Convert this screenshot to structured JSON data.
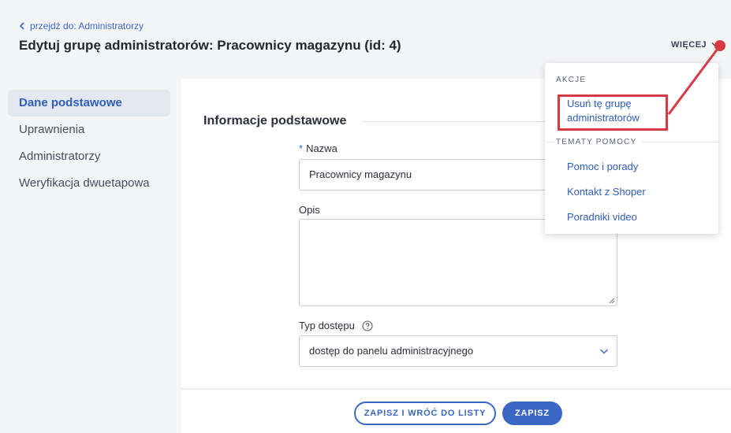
{
  "header": {
    "breadcrumb": "przejdź do: Administratorzy",
    "title": "Edytuj grupę administratorów: Pracownicy magazynu (id: 4)",
    "more_label": "WIĘCEJ"
  },
  "sidebar": {
    "items": [
      {
        "label": "Dane podstawowe",
        "active": true
      },
      {
        "label": "Uprawnienia"
      },
      {
        "label": "Administratorzy"
      },
      {
        "label": "Weryfikacja dwuetapowa"
      }
    ]
  },
  "main": {
    "section_title": "Informacje podstawowe",
    "name": {
      "required_mark": "*",
      "label": "Nazwa",
      "value": "Pracownicy magazynu"
    },
    "description": {
      "label": "Opis",
      "value": ""
    },
    "access_type": {
      "label": "Typ dostępu",
      "value": "dostęp do panelu administracyjnego"
    }
  },
  "footer": {
    "save_and_return_label": "ZAPISZ I WRÓĆ DO LISTY",
    "save_label": "ZAPISZ"
  },
  "dropdown": {
    "actions_heading": "AKCJE",
    "delete_group_line1": "Usuń tę grupę",
    "delete_group_line2": "administratorów",
    "help_heading": "TEMATY POMOCY",
    "help_items": [
      "Pomoc i porady",
      "Kontakt z Shoper",
      "Poradniki video"
    ]
  },
  "colors": {
    "accent": "#3a66c4",
    "annotation_red": "#d83a45"
  }
}
